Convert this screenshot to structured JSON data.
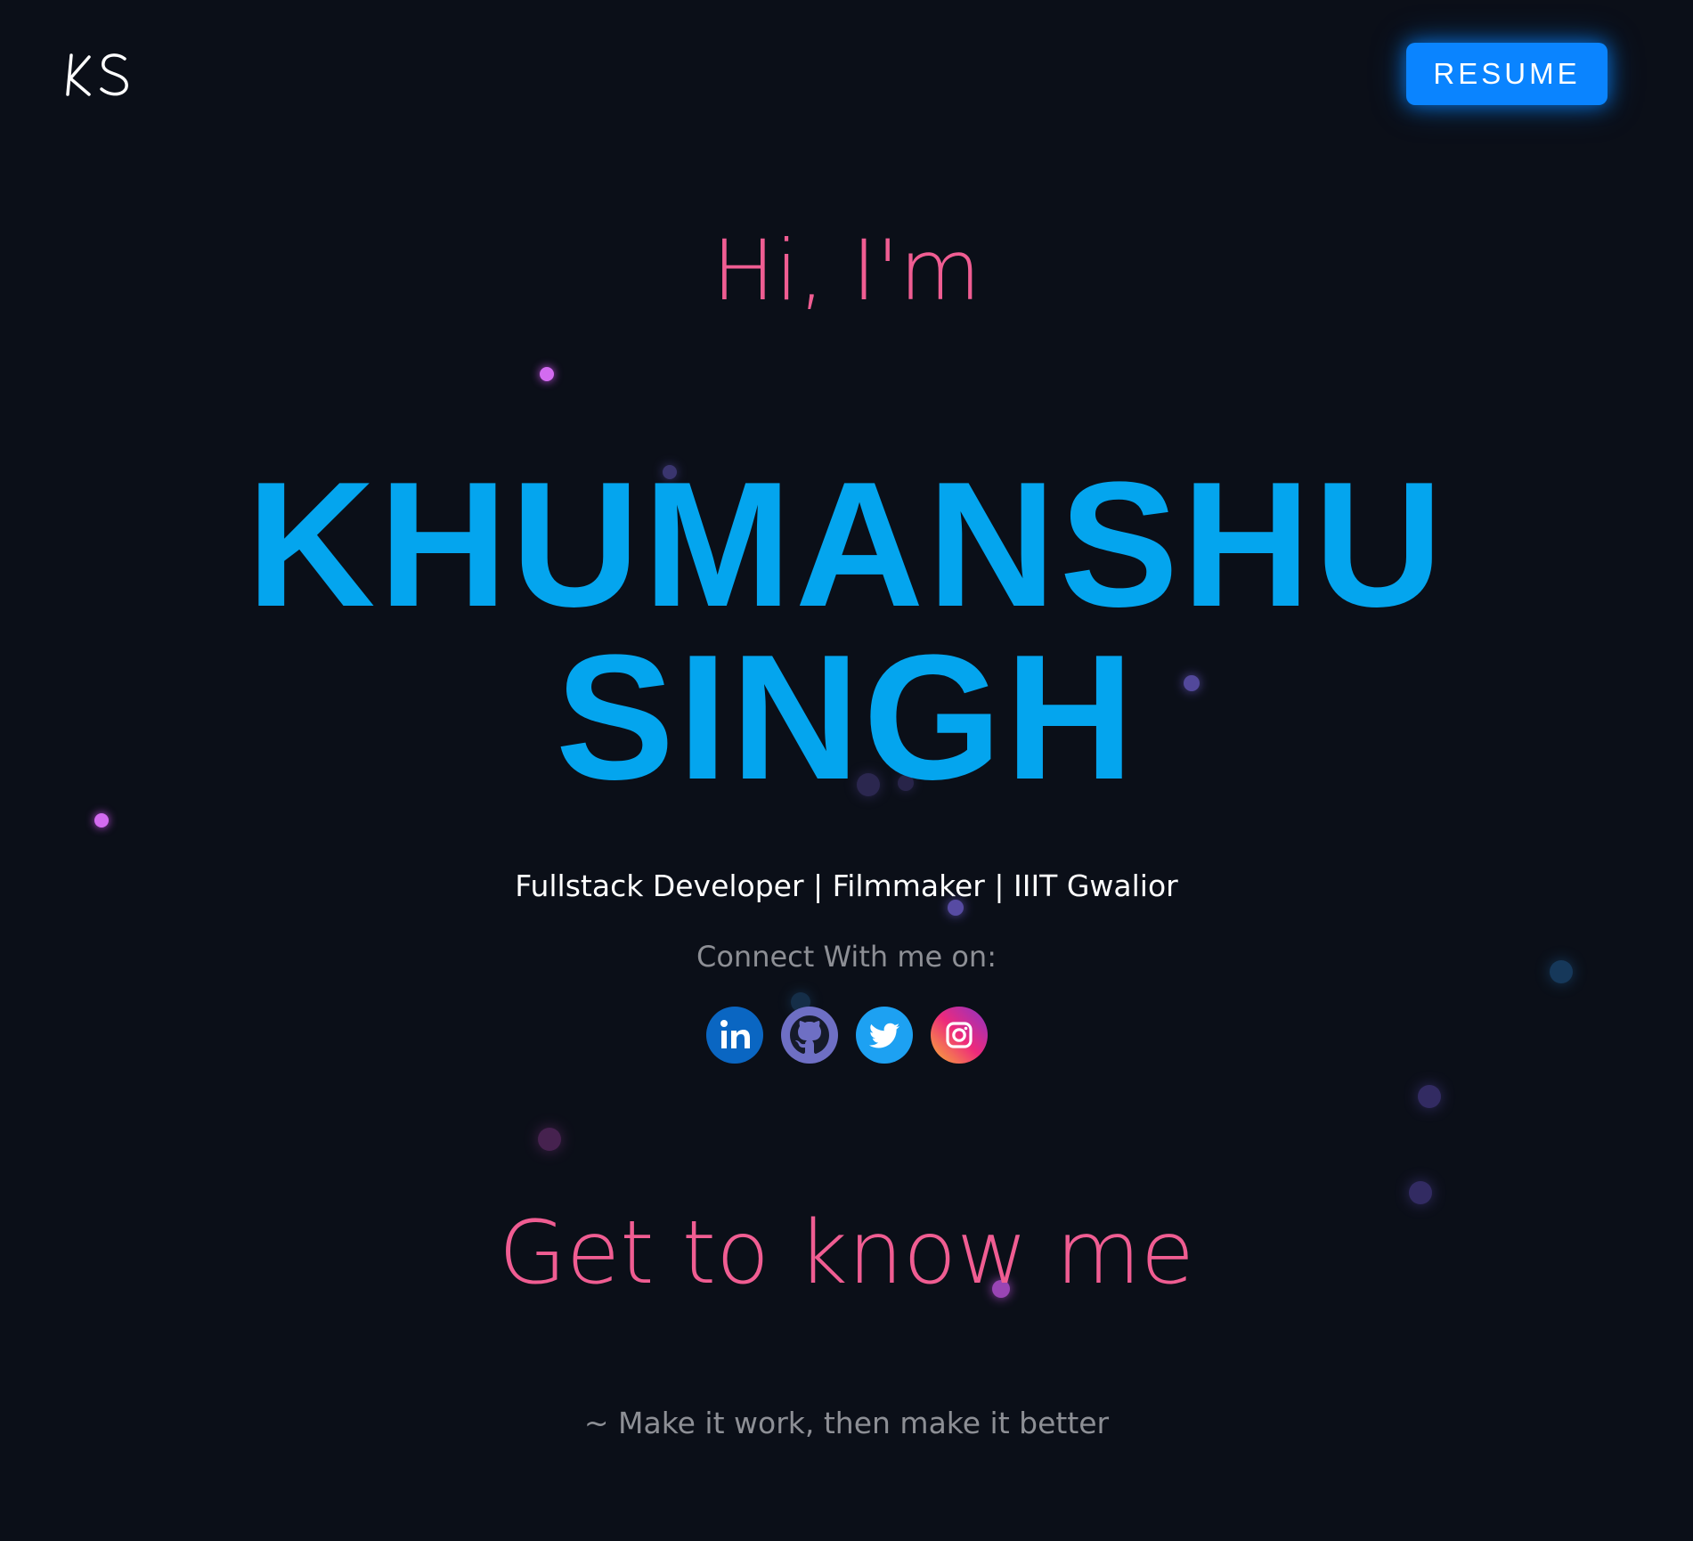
{
  "header": {
    "logo_text": "KS",
    "resume_label": "RESUME"
  },
  "hero": {
    "greeting": "Hi, I'm",
    "name_line_1": "KHUMANSHU",
    "name_line_2": "SINGH",
    "tagline": "Fullstack Developer | Filmmaker | IIIT Gwalior",
    "connect_label": "Connect With me on:"
  },
  "socials": [
    {
      "name": "LinkedIn",
      "icon": "linkedin-icon"
    },
    {
      "name": "GitHub",
      "icon": "github-icon"
    },
    {
      "name": "Twitter",
      "icon": "twitter-icon"
    },
    {
      "name": "Instagram",
      "icon": "instagram-icon"
    }
  ],
  "about": {
    "heading": "Get to know me"
  },
  "footer": {
    "quote": "~ Make it work, then make it better"
  },
  "colors": {
    "background": "#0b0f18",
    "accent_pink": "#f05d92",
    "accent_blue": "#04a5ee",
    "button_blue": "#0a84ff",
    "muted_text": "#8d8f95"
  }
}
